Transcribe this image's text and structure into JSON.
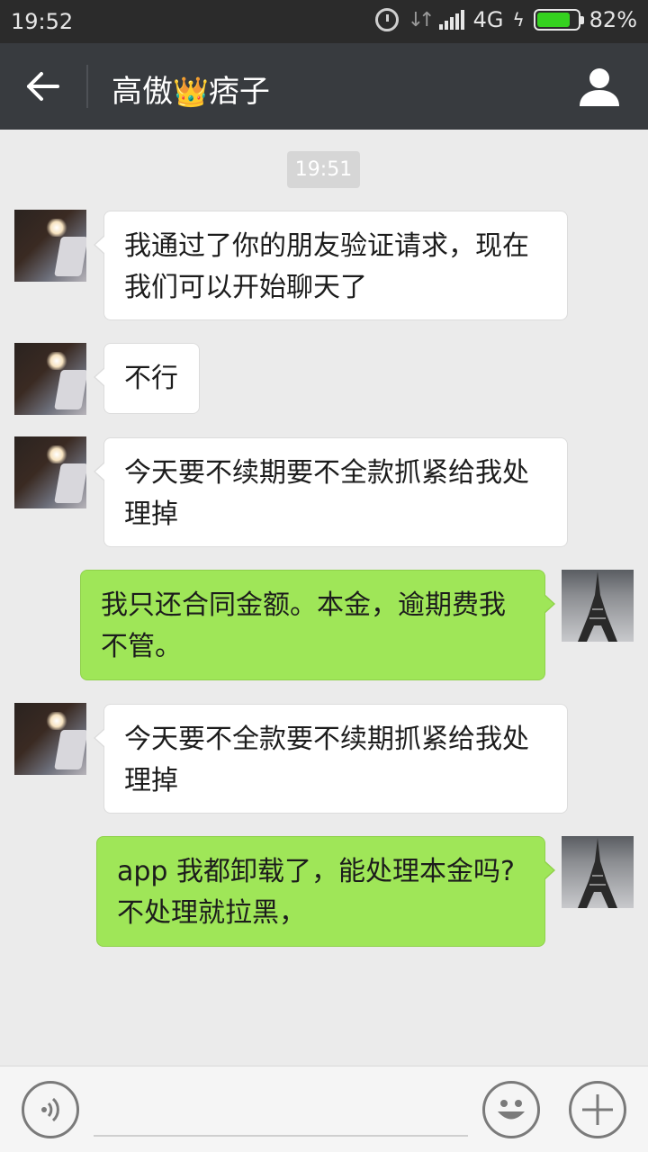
{
  "status_bar": {
    "time": "19:52",
    "network": "4G",
    "battery_percent": "82%",
    "battery_level": 0.82,
    "icons": [
      "alarm-icon",
      "data-arrows-icon",
      "signal-icon",
      "charging-icon",
      "battery-icon"
    ]
  },
  "header": {
    "title_prefix": "高傲",
    "title_emoji": "👑",
    "title_suffix": "痞子",
    "back_icon": "back-arrow-icon",
    "profile_icon": "contact-profile-icon"
  },
  "chat": {
    "timestamp": "19:51",
    "messages": [
      {
        "side": "left",
        "text": "我通过了你的朋友验证请求，现在我们可以开始聊天了"
      },
      {
        "side": "left",
        "text": "不行"
      },
      {
        "side": "left",
        "text": "今天要不续期要不全款抓紧给我处理掉"
      },
      {
        "side": "right",
        "text": "我只还合同金额。本金，逾期费我不管。"
      },
      {
        "side": "left",
        "text": "今天要不全款要不续期抓紧给我处理掉"
      },
      {
        "side": "right",
        "text": "app 我都卸载了，能处理本金吗? 不处理就拉黑，"
      }
    ]
  },
  "input_bar": {
    "placeholder": "",
    "icons": [
      "voice-icon",
      "emoji-icon",
      "plus-icon"
    ]
  },
  "colors": {
    "status_bar_bg": "#2b2b2b",
    "title_bar_bg": "#383b3f",
    "chat_bg": "#ebebeb",
    "bubble_self": "#9fe658",
    "bubble_other": "#ffffff",
    "battery_fill": "#35d21f"
  }
}
